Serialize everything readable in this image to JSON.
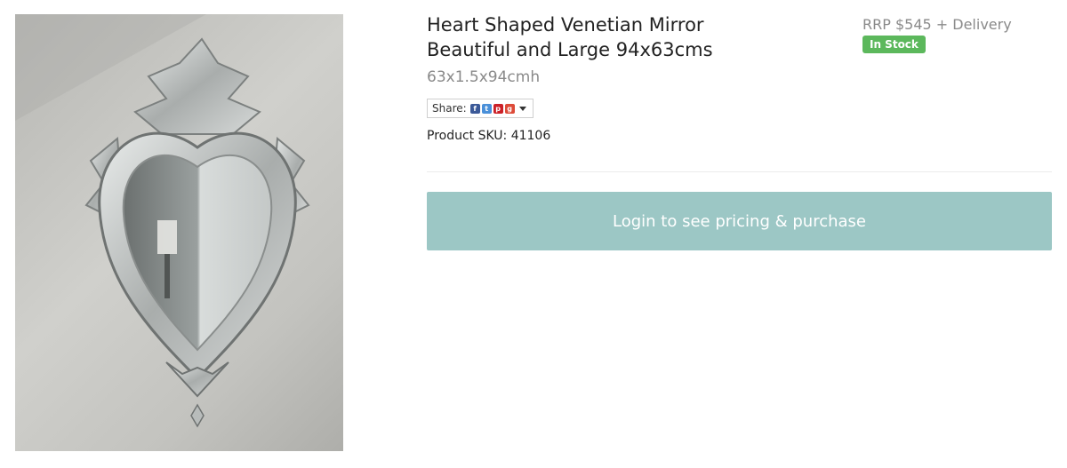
{
  "product": {
    "title": "Heart Shaped Venetian Mirror\nBeautiful and Large 94x63cms",
    "dimensions": "63x1.5x94cmh",
    "sku_label": "Product SKU: 41106",
    "rrp": "RRP $545 + Delivery",
    "stock_badge": "In Stock",
    "image_alt": "Heart shaped Venetian mirror hanging on a wall"
  },
  "share": {
    "label": "Share:",
    "icons": [
      "facebook-icon",
      "twitter-icon",
      "pinterest-icon",
      "google-plus-icon"
    ]
  },
  "cta": {
    "login_label": "Login to see pricing & purchase"
  },
  "colors": {
    "button": "#9cc7c5",
    "badge": "#5cb85c",
    "muted_text": "#8a8a8a"
  }
}
